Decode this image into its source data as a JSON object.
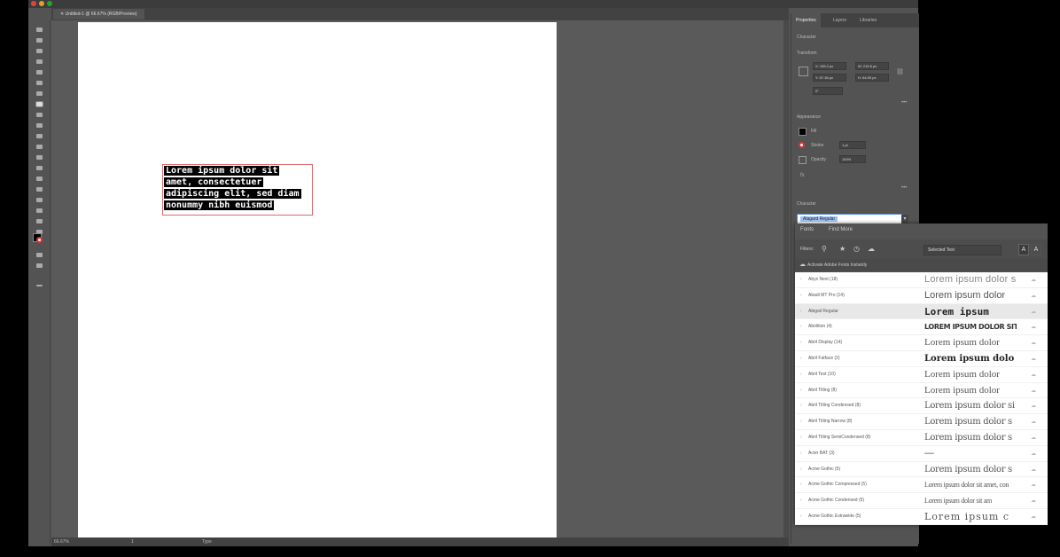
{
  "window": {
    "title": "Untitled-1 @ 66.67% (RGB/Preview)"
  },
  "status": {
    "zoom": "66.67%",
    "artboard": "1",
    "mode": "Type"
  },
  "canvas": {
    "text_lines": [
      "Lorem ipsum dolor sit",
      "amet, consectetuer",
      "adipiscing elit, sed diam",
      "nonummy nibh euismod"
    ]
  },
  "panel": {
    "tabs": [
      "Properties",
      "Layers",
      "Libraries"
    ],
    "sections": {
      "character_group": "Character",
      "transform": "Transform",
      "appearance": "Appearance",
      "character": "Character"
    },
    "transform": {
      "x": "X: 195.2 px",
      "y": "Y: 57.36 px",
      "w": "W: 216.6 px",
      "h": "H: 54.93 px",
      "angle": "0°"
    },
    "appearance": {
      "fill": "Fill",
      "stroke": "Stroke",
      "opacity": "Opacity",
      "opacity_value": "100%",
      "stroke_value": "1 pt"
    },
    "font_input": "Alagard Regular"
  },
  "fontpopup": {
    "tabs": [
      "Fonts",
      "Find More"
    ],
    "filters_label": "Filters:",
    "selected_text_option": "Selected Text",
    "activate_text": "Activate Adobe Fonts Instantly",
    "fonts": [
      {
        "name": "Abyx Next (18)",
        "sample": "Lorem ipsum dolor s",
        "style": "light"
      },
      {
        "name": "Abadi MT Pro (14)",
        "sample": "Lorem ipsum dolor",
        "style": "sans"
      },
      {
        "name": "Abigail Regular",
        "sample": "Lorem ipsum",
        "style": "pixel",
        "highlight": true
      },
      {
        "name": "Abolition (4)",
        "sample": "LOREM IPSUM DOLOR SIT AMET, C",
        "style": "condensed"
      },
      {
        "name": "Abril Display (14)",
        "sample": "Lorem ipsum dolor",
        "style": "serif"
      },
      {
        "name": "Abril Fatface (2)",
        "sample": "Lorem ipsum dolo",
        "style": "fatface"
      },
      {
        "name": "Abril Text (10)",
        "sample": "Lorem ipsum dolor",
        "style": "serif"
      },
      {
        "name": "Abril Titling (8)",
        "sample": "Lorem ipsum dolor",
        "style": "serif"
      },
      {
        "name": "Abril Titling Condensed (8)",
        "sample": "Lorem ipsum dolor si",
        "style": "serifcond"
      },
      {
        "name": "Abril Titling Narrow (8)",
        "sample": "Lorem ipsum dolor s",
        "style": "serifcond"
      },
      {
        "name": "Abril Titling SemiCondensed (8)",
        "sample": "Lorem ipsum dolor s",
        "style": "serifcond"
      },
      {
        "name": "Acier BAT (3)",
        "sample": "—",
        "style": "sans"
      },
      {
        "name": "Acme Gothic (5)",
        "sample": "Lorem ipsum dolor s",
        "style": "serifcond"
      },
      {
        "name": "Acme Gothic Compressed (5)",
        "sample": "Lorem ipsum dolor sit amet, con",
        "style": "compressed"
      },
      {
        "name": "Acme Gothic Condensed (5)",
        "sample": "Lorem ipsum dolor sit am",
        "style": "compressed"
      },
      {
        "name": "Acme Gothic Extrawide (5)",
        "sample": "Lorem ipsum c",
        "style": "wide"
      }
    ]
  },
  "colors": {
    "app_bg": "#535353",
    "accent": "#5b8fd6",
    "artboard": "#ffffff"
  }
}
